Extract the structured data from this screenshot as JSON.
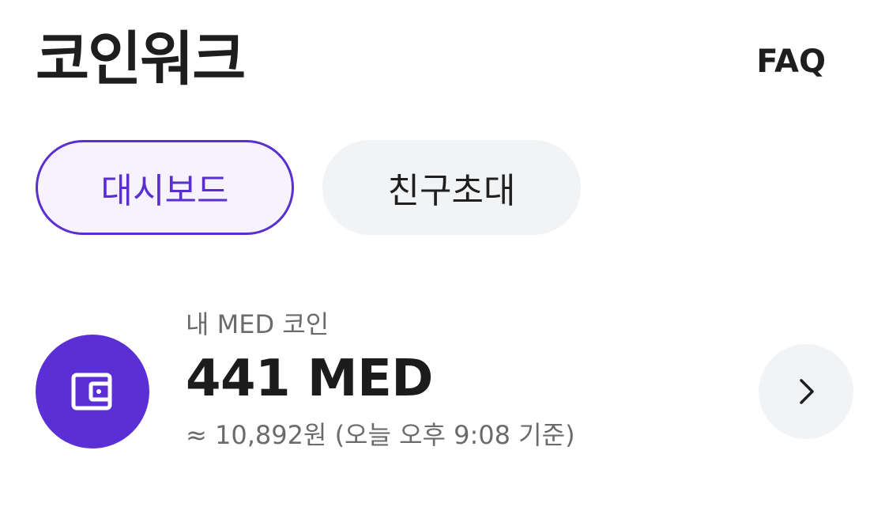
{
  "header": {
    "title": "코인워크",
    "faq_label": "FAQ"
  },
  "tabs": [
    {
      "label": "대시보드",
      "active": true
    },
    {
      "label": "친구초대",
      "active": false
    }
  ],
  "coin_card": {
    "label": "내 MED 코인",
    "amount": "441 MED",
    "krw_text": "≈ 10,892원 (오늘 오후 9:08 기준)",
    "icon": "wallet-icon",
    "action_icon": "chevron-right-icon"
  },
  "colors": {
    "accent": "#5b2fd6",
    "tab_active_bg": "#f6f2fe",
    "neutral_bg": "#f2f3f5",
    "text_primary": "#1e1e1e",
    "text_secondary": "#6b6b6b"
  }
}
